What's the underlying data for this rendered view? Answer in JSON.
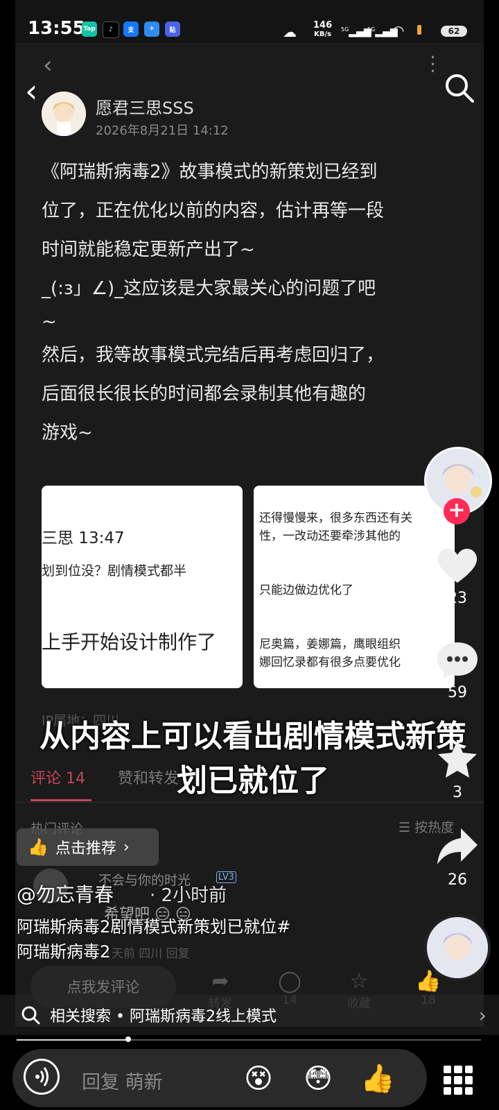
{
  "status_bar": {
    "time": "13:55",
    "app_icons": [
      "Tap",
      "♪",
      "支",
      "✈",
      "贴"
    ],
    "net_speed_value": "146",
    "net_speed_unit": "KB/s",
    "signal_1": "5G",
    "signal_2": "5G",
    "battery": "62"
  },
  "post": {
    "author": "愿君三思SSS",
    "date": "2026年8月21日 14:12",
    "text_lines": [
      "《阿瑞斯病毒2》故事模式的新策划已经到",
      "位了，正在优化以前的内容，估计再等一段",
      "时间就能稳定更新产出了~",
      "_(:з」∠)_这应该是大家最关心的问题了吧",
      "~",
      "然后，我等故事模式完结后再考虑回归了，",
      "后面很长很长的时间都会录制其他有趣的",
      "游戏~"
    ],
    "screenshot_left": {
      "line1": "三思 13:47",
      "line2": "划到位没？剧情模式都半",
      "line3": "上手开始设计制作了"
    },
    "screenshot_right": {
      "line1": "还得慢慢来，很多东西还有关",
      "line2": "性，一改动还要牵涉其他的",
      "line3": "只能边做边优化了",
      "line4": "尼奥篇，姜娜篇，鹰眼组织",
      "line5": "娜回忆录都有很多点要优化"
    },
    "ip_location": "IP属地：四川",
    "tab_comments": "评论 14",
    "tab_likes": "赞和转发",
    "hot_comments_label": "热门评论",
    "sort_label": "☰ 按热度",
    "commenter_name": "不会与你的时光",
    "commenter_level": "LV3",
    "comment_text": "希望吧 😑 😑",
    "comment_meta": "1天前  四川  回复",
    "comment_input_placeholder": "点我发评论",
    "actions": [
      {
        "icon": "share-icon",
        "glyph": "➦",
        "label": "转发"
      },
      {
        "icon": "comment-icon",
        "glyph": "◯",
        "label": "14"
      },
      {
        "icon": "star-icon",
        "glyph": "☆",
        "label": "收藏"
      },
      {
        "icon": "like-icon",
        "glyph": "👍",
        "label": "18"
      }
    ]
  },
  "overlay_caption": {
    "line1": "从内容上可以看出剧情模式新策",
    "line2": "划已就位了"
  },
  "rail": {
    "likes": "23",
    "comments": "59",
    "favorites": "3",
    "shares": "26",
    "follow_symbol": "+"
  },
  "video_info": {
    "recommend_label": "点击推荐",
    "account": "@勿忘青春",
    "time_ago": "· 2小时前",
    "description_line1": "阿瑞斯病毒2剧情模式新策划已就位#",
    "description_line2": "阿瑞斯病毒2",
    "related_search": "相关搜索 • 阿瑞斯病毒2线上模式",
    "progress": 0.24
  },
  "bottom_bar": {
    "reply_placeholder": "回复 萌新",
    "emojis": [
      "😵",
      "😳",
      "👍"
    ]
  },
  "colors": {
    "accent_red": "#fe2c55",
    "comment_tab": "#c2465a"
  }
}
